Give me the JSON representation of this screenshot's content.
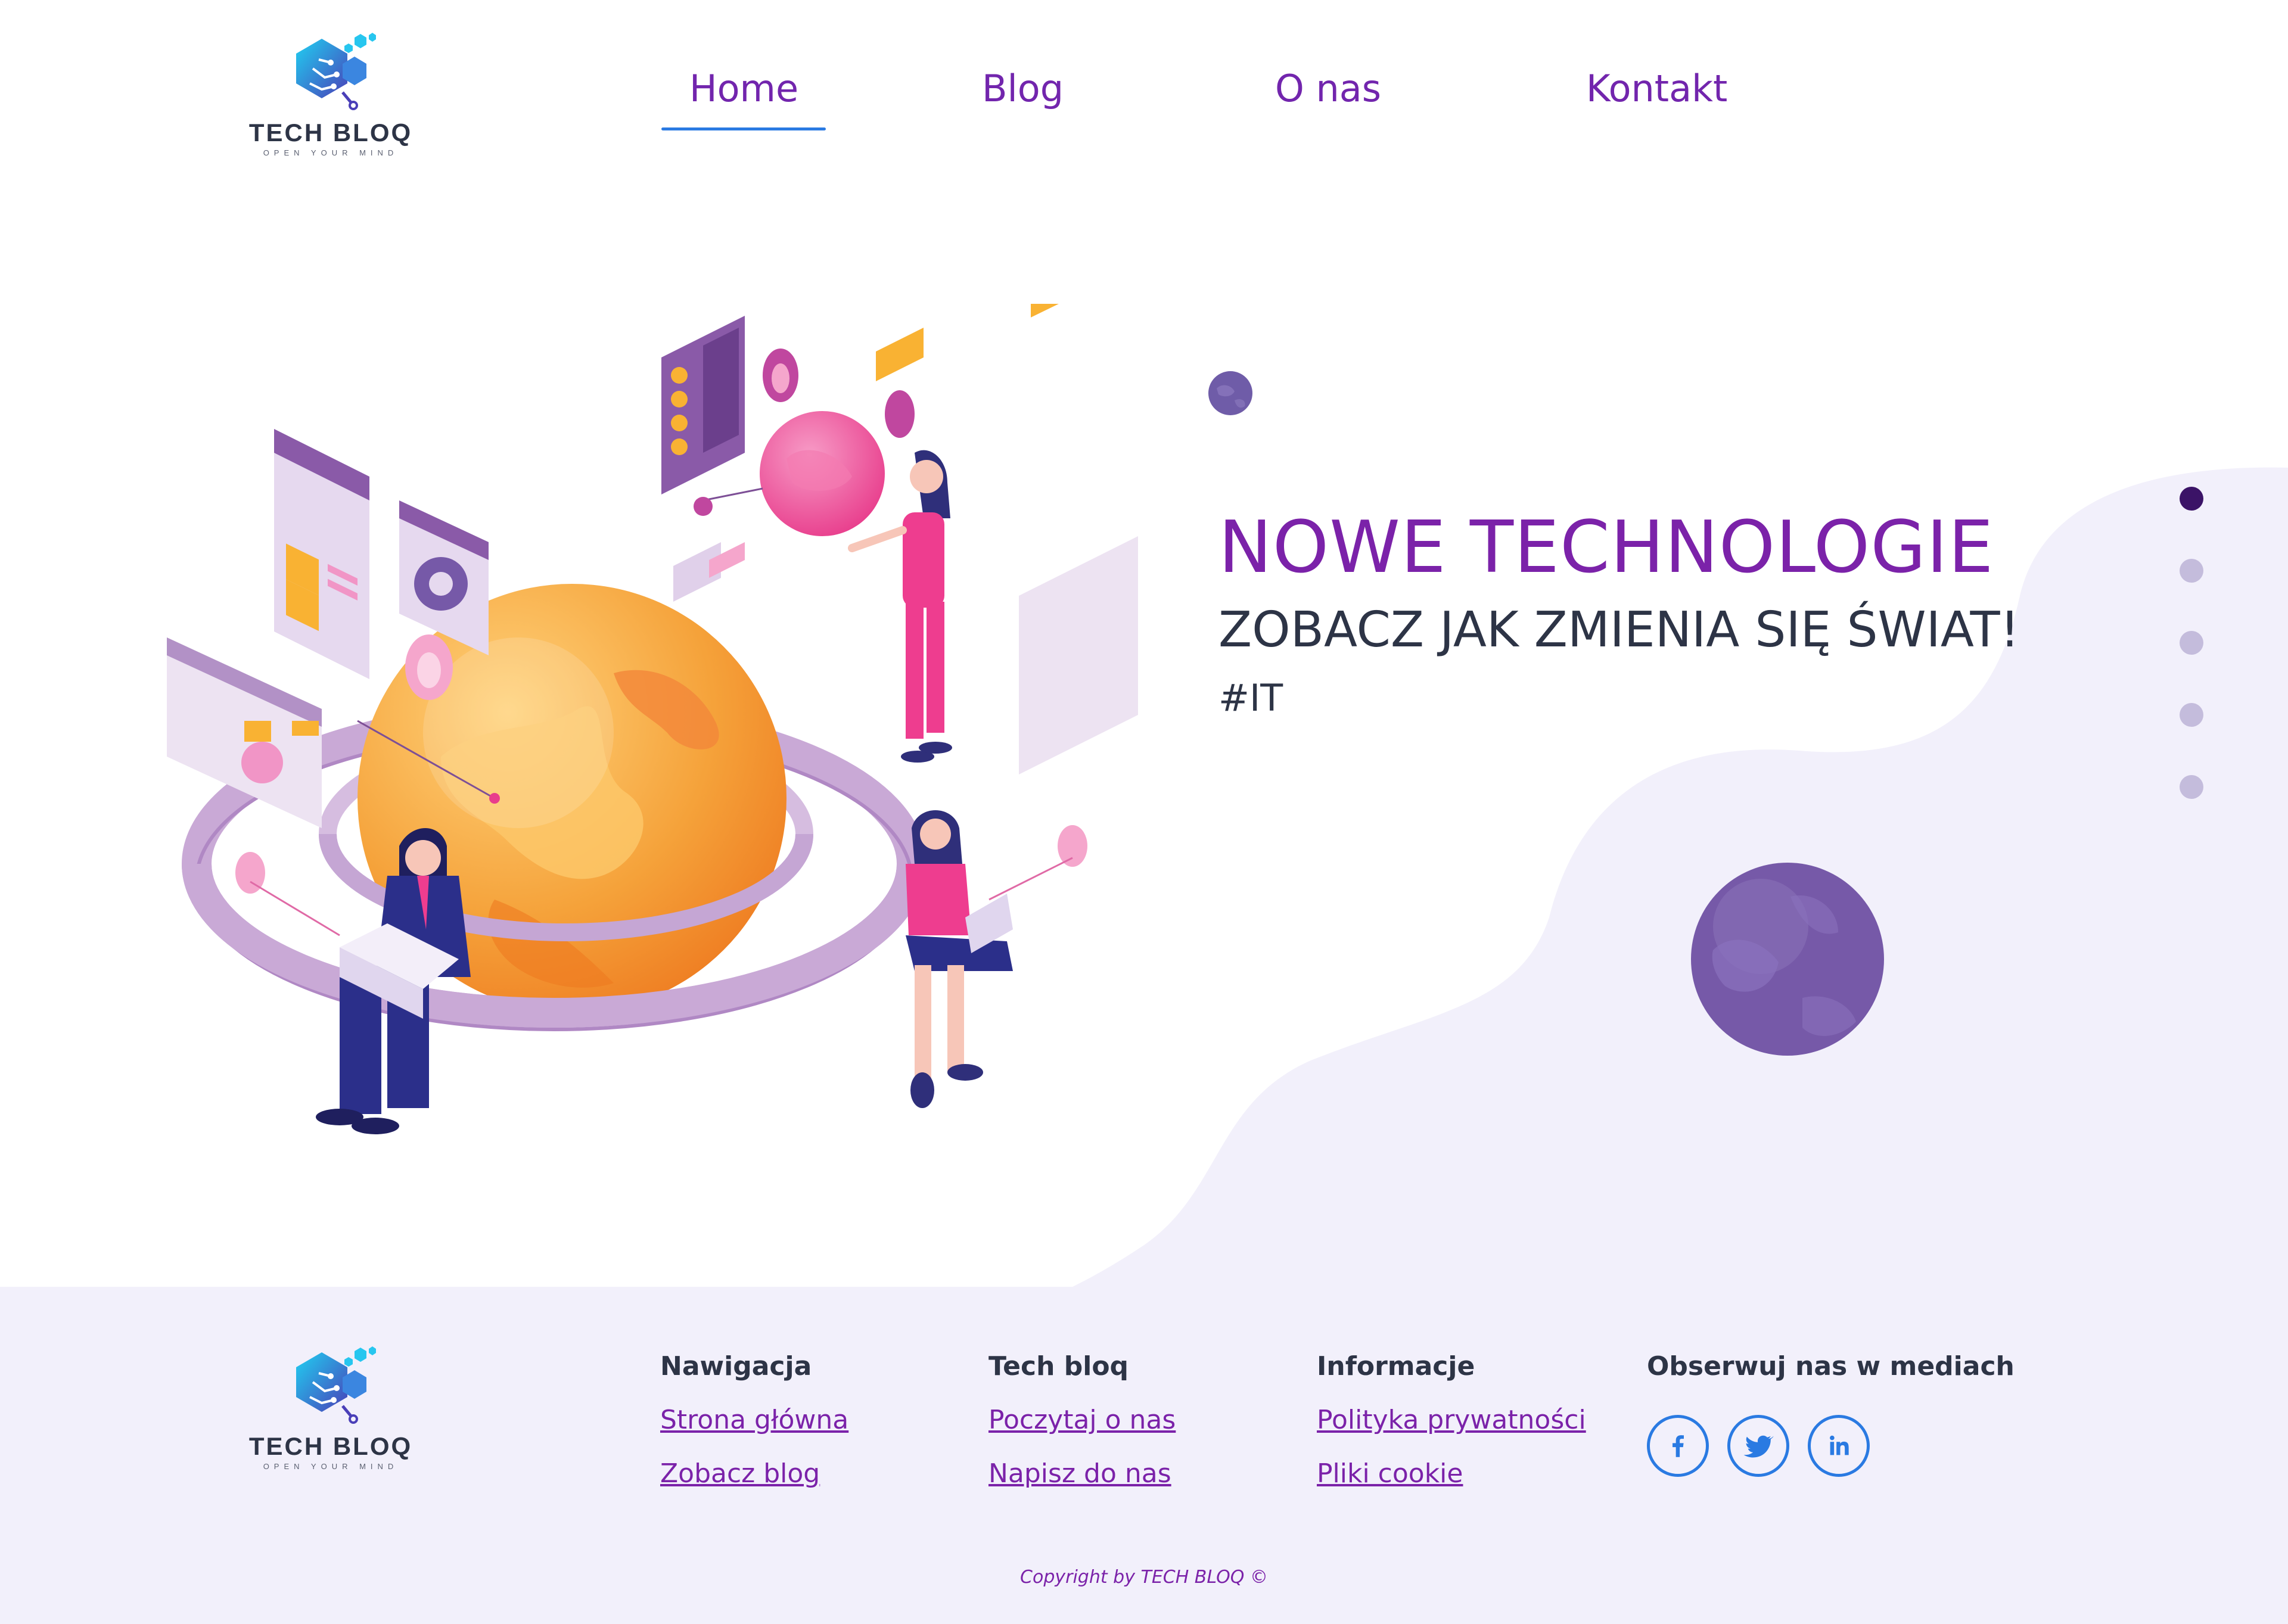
{
  "brand": {
    "name": "TECH BLOQ",
    "tagline": "OPEN YOUR MIND"
  },
  "nav": {
    "items": [
      {
        "label": "Home",
        "active": true
      },
      {
        "label": "Blog"
      },
      {
        "label": "O nas"
      },
      {
        "label": "Kontakt"
      }
    ]
  },
  "hero": {
    "title": "NOWE TECHNOLOGIE",
    "subtitle": "ZOBACZ JAK ZMIENIA SIĘ ŚWIAT!",
    "tag": "#IT",
    "slides": {
      "count": 5,
      "active_index": 0
    }
  },
  "footer": {
    "columns": [
      {
        "heading": "Nawigacja",
        "links": [
          "Strona główna",
          "Zobacz blog"
        ]
      },
      {
        "heading": "Tech bloq",
        "links": [
          "Poczytaj o nas",
          "Napisz do nas"
        ]
      },
      {
        "heading": "Informacje",
        "links": [
          "Polityka prywatności",
          "Pliki cookie"
        ]
      }
    ],
    "social": {
      "heading": "Obserwuj nas w mediach",
      "icons": [
        "facebook-icon",
        "twitter-icon",
        "linkedin-icon"
      ]
    },
    "copyright": "Copyright by TECH BLOQ ©"
  },
  "colors": {
    "primary_purple": "#7b22a9",
    "nav_text": "#7225ad",
    "dark_text": "#2d3446",
    "accent_blue": "#2a7ae2",
    "footer_bg": "#f2f0fb",
    "planet": "#7659a8",
    "globe_orange": "#f5a23a",
    "pink": "#ee3d8f"
  }
}
